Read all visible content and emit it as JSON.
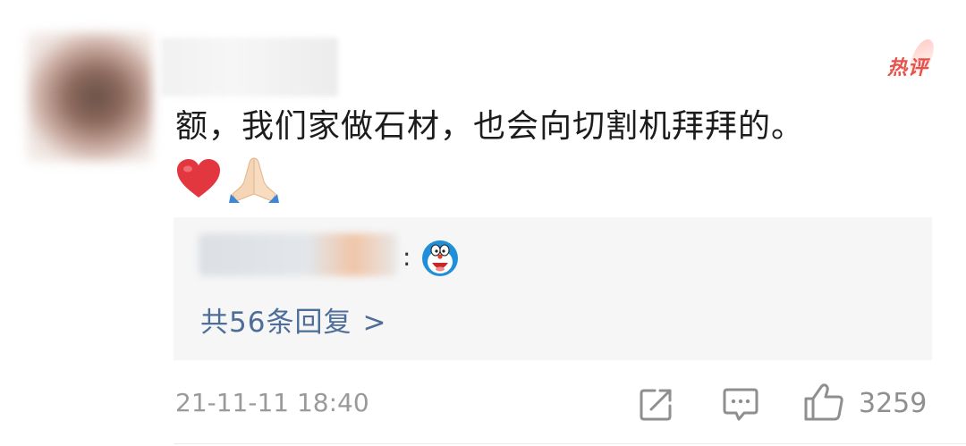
{
  "comment": {
    "badge": "热评",
    "text": "额，我们家做石材，也会向切割机拜拜的。",
    "emojis": [
      "heart-icon",
      "pray-icon"
    ]
  },
  "reply": {
    "separator": ":",
    "emoji": "doraemon-icon",
    "count_label": "共56条回复",
    "chevron": ">"
  },
  "footer": {
    "timestamp": "21-11-11 18:40",
    "like_count": "3259"
  },
  "colors": {
    "link": "#4e6e9a",
    "badge": "#e7524a",
    "muted": "#9a9a9a",
    "heart": "#e2373f"
  }
}
